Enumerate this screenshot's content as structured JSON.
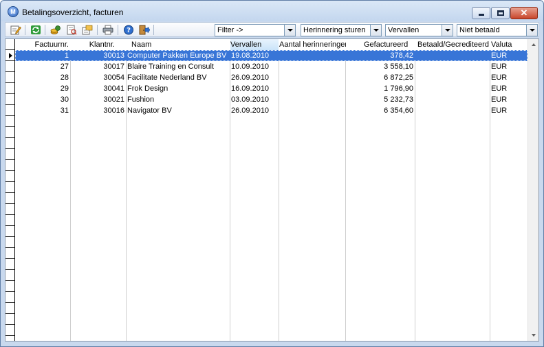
{
  "window": {
    "title": "Betalingsoverzicht, facturen",
    "app_icon": "app-logo-icon",
    "controls": {
      "minimize": "minimize-icon",
      "maximize": "maximize-icon",
      "close": "close-icon"
    }
  },
  "toolbar": {
    "icons": [
      "edit-icon",
      "refresh-icon",
      "coins-icon",
      "document-search-icon",
      "document-export-icon",
      "print-icon",
      "help-icon",
      "exit-icon"
    ],
    "filters": [
      {
        "value": "Filter ->"
      },
      {
        "value": "Herinnering sturen"
      },
      {
        "value": "Vervallen"
      },
      {
        "value": "Niet betaald"
      }
    ]
  },
  "grid": {
    "columns": [
      "Factuurnr.",
      "Klantnr.",
      "Naam",
      "Vervallen",
      "Aantal herinneringen",
      "Gefactureerd",
      "Betaald/Gecrediteerd",
      "Valuta"
    ],
    "sorted_column": "Vervallen",
    "rows": [
      {
        "factuurnr": "1",
        "klantnr": "30013",
        "naam": "Computer Pakken Europe BV",
        "vervallen": "19.08.2010",
        "herinneringen": "",
        "gefactureerd": "378,42",
        "betaald": "",
        "valuta": "EUR",
        "selected": true
      },
      {
        "factuurnr": "27",
        "klantnr": "30017",
        "naam": "Blaire Training en Consult",
        "vervallen": "10.09.2010",
        "herinneringen": "",
        "gefactureerd": "3 558,10",
        "betaald": "",
        "valuta": "EUR"
      },
      {
        "factuurnr": "28",
        "klantnr": "30054",
        "naam": "Facilitate Nederland BV",
        "vervallen": "26.09.2010",
        "herinneringen": "",
        "gefactureerd": "6 872,25",
        "betaald": "",
        "valuta": "EUR"
      },
      {
        "factuurnr": "29",
        "klantnr": "30041",
        "naam": "Frok Design",
        "vervallen": "16.09.2010",
        "herinneringen": "",
        "gefactureerd": "1 796,90",
        "betaald": "",
        "valuta": "EUR"
      },
      {
        "factuurnr": "30",
        "klantnr": "30021",
        "naam": "Fushion",
        "vervallen": "03.09.2010",
        "herinneringen": "",
        "gefactureerd": "5 232,73",
        "betaald": "",
        "valuta": "EUR"
      },
      {
        "factuurnr": "31",
        "klantnr": "30016",
        "naam": "Navigator BV",
        "vervallen": "26.09.2010",
        "herinneringen": "",
        "gefactureerd": "6 354,60",
        "betaald": "",
        "valuta": "EUR"
      }
    ]
  },
  "colors": {
    "selection": "#3875d7",
    "title_gradient_top": "#dbe8f7",
    "close_button": "#c8452b"
  }
}
